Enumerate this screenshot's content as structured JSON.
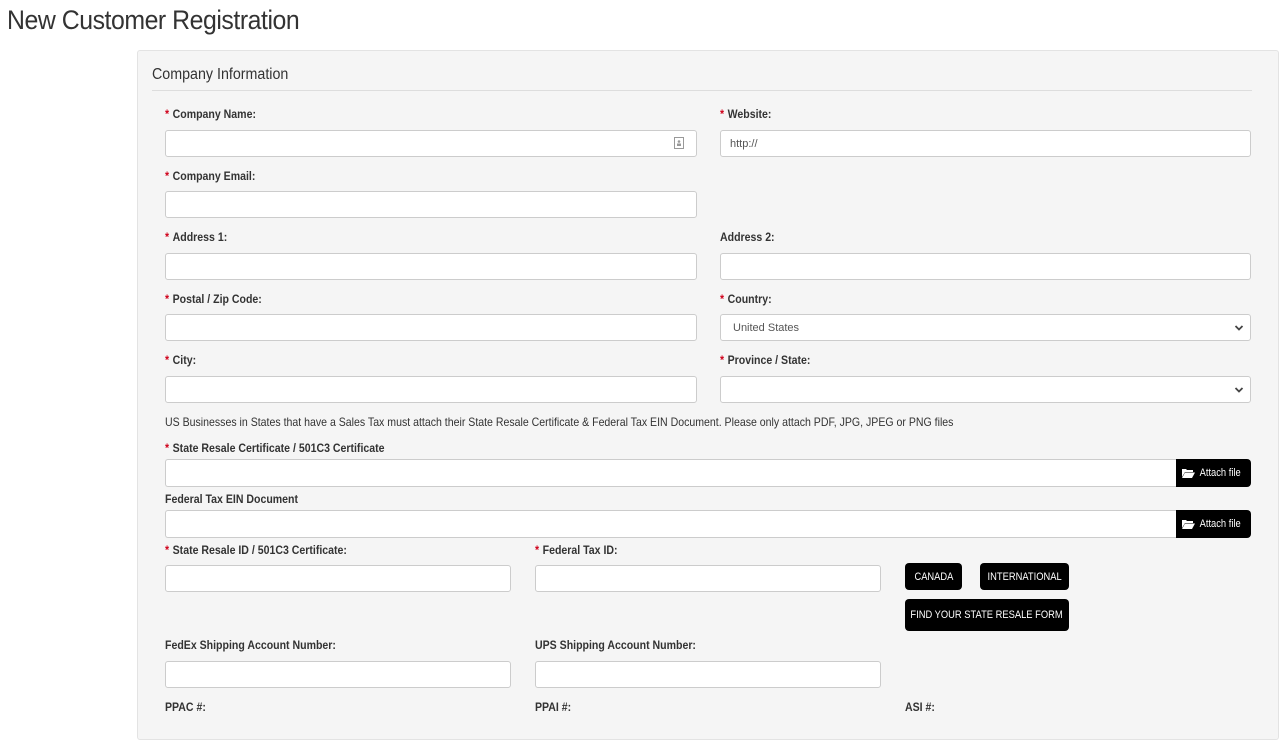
{
  "page": {
    "title": "New Customer Registration"
  },
  "panel": {
    "title": "Company Information"
  },
  "required_marker": "*",
  "fields": {
    "company_name": {
      "label": "Company Name:",
      "value": ""
    },
    "website": {
      "label": "Website:",
      "value": "http://"
    },
    "company_email": {
      "label": "Company Email:",
      "value": ""
    },
    "address1": {
      "label": "Address 1:",
      "value": ""
    },
    "address2": {
      "label": "Address 2:",
      "value": ""
    },
    "postal": {
      "label": "Postal / Zip Code:",
      "value": ""
    },
    "country": {
      "label": "Country:",
      "selected": "United States"
    },
    "city": {
      "label": "City:",
      "value": ""
    },
    "province": {
      "label": "Province / State:",
      "selected": ""
    },
    "state_resale_id": {
      "label": "State Resale ID / 501C3 Certificate:",
      "value": ""
    },
    "federal_tax_id": {
      "label": "Federal Tax ID:",
      "value": ""
    },
    "fedex": {
      "label": "FedEx Shipping Account Number:",
      "value": ""
    },
    "ups": {
      "label": "UPS Shipping Account Number:",
      "value": ""
    },
    "ppac": {
      "label": "PPAC #:"
    },
    "ppai": {
      "label": "PPAI #:"
    },
    "asi": {
      "label": "ASI #:"
    }
  },
  "notice": "US Businesses in States that have a Sales Tax must attach their State Resale Certificate & Federal Tax EIN Document. Please only attach PDF, JPG, JPEG or PNG files",
  "attachments": {
    "resale_certificate": {
      "label": "State Resale Certificate / 501C3 Certificate",
      "button": "Attach file"
    },
    "ein_document": {
      "label": "Federal Tax EIN Document",
      "button": "Attach file"
    }
  },
  "buttons": {
    "canada": "CANADA",
    "international": "INTERNATIONAL",
    "find_state_form": "FIND YOUR STATE RESALE FORM"
  },
  "colors": {
    "required": "#d0021b",
    "button_bg": "#000000",
    "panel_bg": "#f5f5f5"
  }
}
